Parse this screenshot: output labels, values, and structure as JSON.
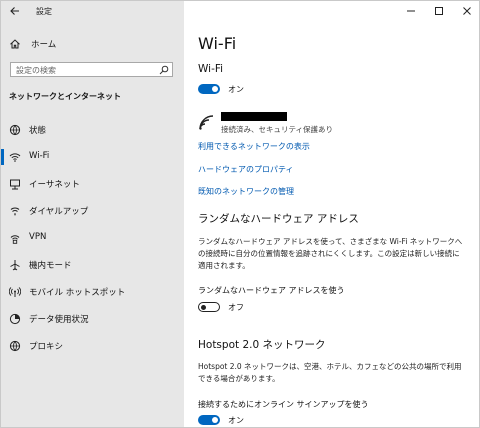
{
  "app": {
    "title": "設定"
  },
  "sidebar": {
    "home_label": "ホーム",
    "search_placeholder": "設定の検索",
    "section_heading": "ネットワークとインターネット",
    "items": [
      {
        "label": "状態",
        "icon": "globe-icon"
      },
      {
        "label": "Wi-Fi",
        "icon": "wifi-icon",
        "active": true
      },
      {
        "label": "イーサネット",
        "icon": "ethernet-icon"
      },
      {
        "label": "ダイヤルアップ",
        "icon": "dialup-icon"
      },
      {
        "label": "VPN",
        "icon": "vpn-icon"
      },
      {
        "label": "機内モード",
        "icon": "airplane-icon"
      },
      {
        "label": "モバイル ホットスポット",
        "icon": "hotspot-icon"
      },
      {
        "label": "データ使用状況",
        "icon": "data-usage-icon"
      },
      {
        "label": "プロキシ",
        "icon": "proxy-globe-icon"
      }
    ]
  },
  "main": {
    "page_title": "Wi-Fi",
    "wifi_heading": "Wi-Fi",
    "wifi_toggle_state": "オン",
    "network_status": "接続済み、セキュリティ保護あり",
    "links": {
      "show_networks": "利用できるネットワークの表示",
      "hardware_properties": "ハードウェアのプロパティ",
      "manage_known": "既知のネットワークの管理"
    },
    "random_hw": {
      "heading": "ランダムなハードウェア アドレス",
      "description": "ランダムなハードウェア アドレスを使って、さまざまな Wi-Fi ネットワークへの接続時に自分の位置情報を追跡されにくくします。この設定は新しい接続に適用されます。",
      "toggle_label": "ランダムなハードウェア アドレスを使う",
      "toggle_state": "オフ"
    },
    "hotspot20": {
      "heading": "Hotspot 2.0 ネットワーク",
      "description": "Hotspot 2.0 ネットワークは、空港、ホテル、カフェなどの公共の場所で利用できる場合があります。",
      "toggle_label": "接続するためにオンライン サインアップを使う",
      "toggle_state": "オン"
    }
  },
  "colors": {
    "accent": "#0067c0",
    "sidebar_bg": "#e7e7e7",
    "link": "#0059b0"
  }
}
